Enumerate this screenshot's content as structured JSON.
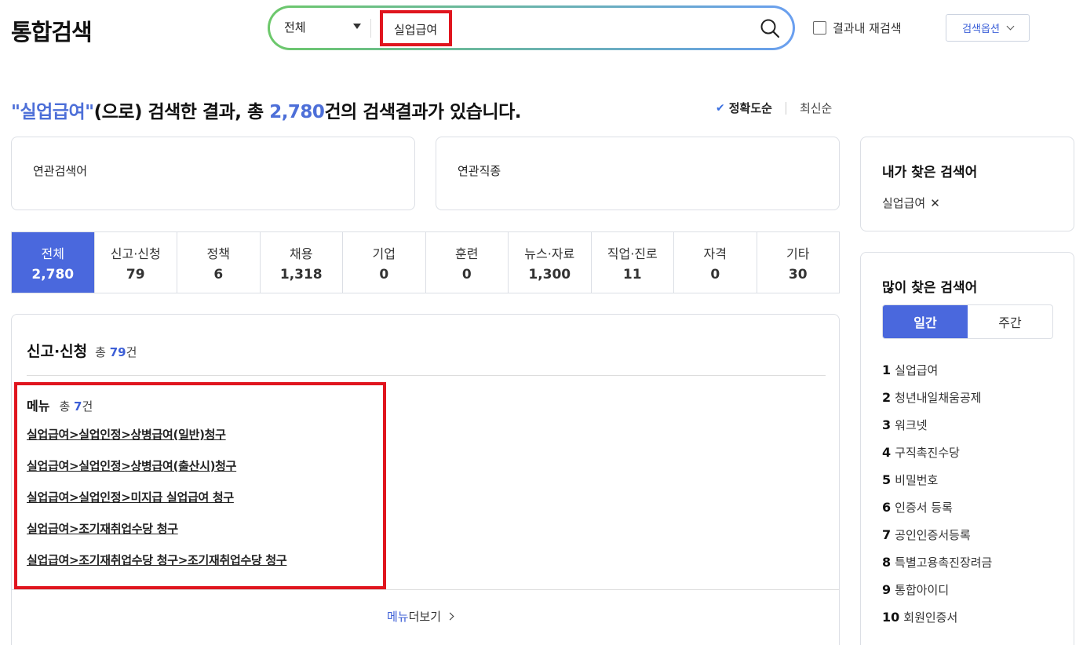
{
  "page_title": "통합검색",
  "search": {
    "scope": "전체",
    "query": "실업급여",
    "refine_label": "결과내 재검색",
    "options_label": "검색옵션"
  },
  "summary": {
    "query_quoted": "\"실업급여\"",
    "middle": "(으로) 검색한 결과, 총 ",
    "total": "2,780",
    "tail": "건의 검색결과가 있습니다."
  },
  "sort": {
    "accuracy": "정확도순",
    "latest": "최신순"
  },
  "related": {
    "keywords_title": "연관검색어",
    "jobs_title": "연관직종"
  },
  "tabs": [
    {
      "label": "전체",
      "count": "2,780"
    },
    {
      "label": "신고·신청",
      "count": "79"
    },
    {
      "label": "정책",
      "count": "6"
    },
    {
      "label": "채용",
      "count": "1,318"
    },
    {
      "label": "기업",
      "count": "0"
    },
    {
      "label": "훈련",
      "count": "0"
    },
    {
      "label": "뉴스·자료",
      "count": "1,300"
    },
    {
      "label": "직업·진로",
      "count": "11"
    },
    {
      "label": "자격",
      "count": "0"
    },
    {
      "label": "기타",
      "count": "30"
    }
  ],
  "section": {
    "title": "신고·신청",
    "total_prefix": "총 ",
    "total": "79",
    "total_suffix": "건"
  },
  "menu": {
    "title": "메뉴",
    "total_prefix": "총 ",
    "total": "7",
    "total_suffix": "건",
    "links": [
      "실업급여>실업인정>상병급여(일반)청구",
      "실업급여>실업인정>상병급여(출산시)청구",
      "실업급여>실업인정>미지급 실업급여 청구",
      "실업급여>조기재취업수당 청구",
      "실업급여>조기재취업수당 청구>조기재취업수당 청구"
    ],
    "more_prefix": "메뉴",
    "more_suffix": " 더보기"
  },
  "my_searches": {
    "title": "내가 찾은 검색어",
    "items": [
      "실업급여"
    ]
  },
  "popular": {
    "title": "많이 찾은 검색어",
    "daily": "일간",
    "weekly": "주간",
    "items": [
      {
        "rank": "1",
        "term": "실업급여"
      },
      {
        "rank": "2",
        "term": "청년내일채움공제"
      },
      {
        "rank": "3",
        "term": "워크넷"
      },
      {
        "rank": "4",
        "term": "구직촉진수당"
      },
      {
        "rank": "5",
        "term": "비밀번호"
      },
      {
        "rank": "6",
        "term": "인증서 등록"
      },
      {
        "rank": "7",
        "term": "공인인증서등록"
      },
      {
        "rank": "8",
        "term": "특별고용촉진장려금"
      },
      {
        "rank": "9",
        "term": "통합아이디"
      },
      {
        "rank": "10",
        "term": "회원인증서"
      }
    ]
  },
  "colors": {
    "accent": "#4a68dd",
    "highlight_box": "#e0151e",
    "link_blue": "#3d5fd6"
  }
}
